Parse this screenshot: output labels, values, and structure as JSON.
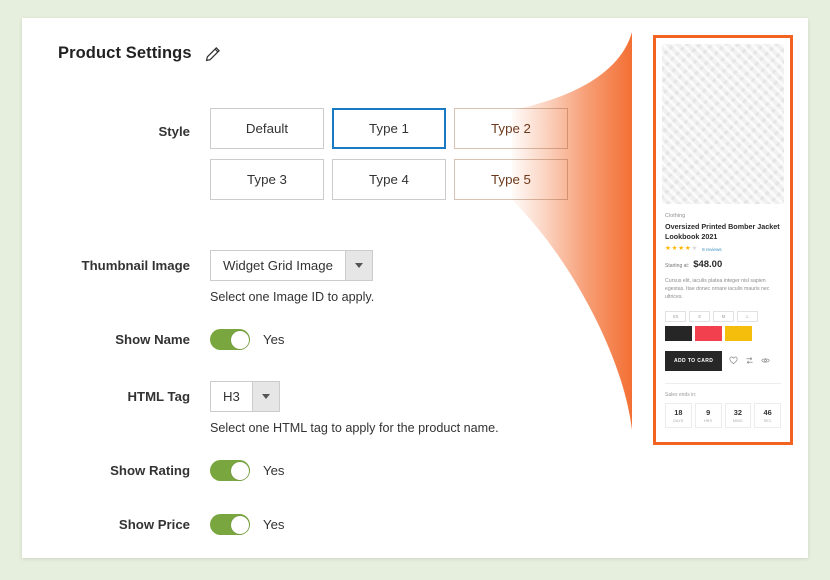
{
  "page": {
    "title": "Product Settings",
    "edit_icon": "pencil-icon",
    "background_color": "#e6eedd",
    "panel_color": "#ffffff"
  },
  "theme": {
    "accent_orange": "#f26322",
    "selected_blue": "#1979c3",
    "toggle_green": "#79a63f",
    "star_gold": "#ffb600",
    "link_blue": "#3a8fc4"
  },
  "form": {
    "style": {
      "label": "Style",
      "selected": "Type 1",
      "options": [
        {
          "label": "Default",
          "state": "normal"
        },
        {
          "label": "Type 1",
          "state": "selected"
        },
        {
          "label": "Type 2",
          "state": "beam"
        },
        {
          "label": "Type 3",
          "state": "normal"
        },
        {
          "label": "Type 4",
          "state": "normal"
        },
        {
          "label": "Type 5",
          "state": "beam"
        }
      ]
    },
    "thumbnail_image": {
      "label": "Thumbnail Image",
      "value": "Widget Grid Image",
      "hint": "Select one Image ID to apply.",
      "caret_icon": "chevron-down-icon"
    },
    "show_name": {
      "label": "Show Name",
      "value": "Yes",
      "on": true
    },
    "html_tag": {
      "label": "HTML Tag",
      "value": "H3",
      "hint": "Select one HTML tag to apply for the product name.",
      "caret_icon": "chevron-down-icon"
    },
    "show_rating": {
      "label": "Show Rating",
      "value": "Yes",
      "on": true
    },
    "show_price": {
      "label": "Show Price",
      "value": "Yes",
      "on": true
    }
  },
  "preview": {
    "image_placeholder": "product-image-placeholder",
    "category": "Clothing",
    "name": "Oversized Printed Bomber Jacket Lookbook 2021",
    "rating": {
      "filled": 4,
      "total": 5,
      "reviews_text": "8 reviews"
    },
    "price_label": "Starting at:",
    "price": "$48.00",
    "description": "Cursus elit, iaculis platea integer nisl sapien egestas. Itae donec ornare iaculis mauris nec ultrices.",
    "sizes": [
      "XS",
      "S",
      "M",
      "L"
    ],
    "colors": [
      {
        "name": "black",
        "hex": "#262626"
      },
      {
        "name": "red",
        "hex": "#f2404f"
      },
      {
        "name": "yellow",
        "hex": "#f5bd0c"
      }
    ],
    "add_to_cart_label": "ADD TO CARD",
    "action_icons": [
      "heart-icon",
      "compare-icon",
      "eye-icon"
    ],
    "sales_label": "Sales ends in:",
    "countdown": [
      {
        "num": "18",
        "unit": "DAYS"
      },
      {
        "num": "9",
        "unit": "HRS"
      },
      {
        "num": "32",
        "unit": "MINS"
      },
      {
        "num": "46",
        "unit": "SEC"
      }
    ]
  }
}
